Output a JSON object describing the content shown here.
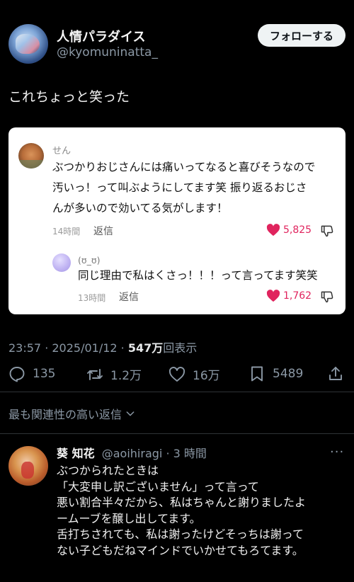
{
  "author": {
    "display_name": "人情パラダイス",
    "handle": "@kyomuninatta_",
    "follow_label": "フォローする"
  },
  "tweet": {
    "text": "これちょっと笑った"
  },
  "embedded": {
    "comment": {
      "name": "せん",
      "lines": [
        "ぶつかりおじさんには痛いってなると喜びそうなので",
        "汚いっ！って叫ぶようにしてます笑 振り返るおじさ",
        "んが多いので効いてる気がします！"
      ],
      "time": "14時間",
      "reply_label": "返信",
      "likes": "5,825"
    },
    "reply": {
      "name": "(ʊ_ʊ)",
      "text": "同じ理由で私はくさっ！！！って言ってます笑笑",
      "time": "13時間",
      "reply_label": "返信",
      "likes": "1,762"
    }
  },
  "meta": {
    "datetime": "23:57 · 2025/01/12 · ",
    "views": "547万",
    "views_suffix": "回表示"
  },
  "stats": {
    "replies": "135",
    "retweets": "1.2万",
    "likes": "16万",
    "bookmarks": "5489"
  },
  "sort": {
    "label": "最も関連性の高い返信"
  },
  "reply": {
    "name": "葵 知花",
    "handle": "@aoihiragi",
    "time": "· 3 時間",
    "more": "···",
    "lines": [
      "ぶつかられたときは",
      "「大変申し訳ございません」って言って",
      "悪い割合半々だから、私はちゃんと謝りましたよ",
      "ームーブを醸し出してます。",
      "舌打ちされても、私は謝ったけどそっちは謝って",
      "ない子どもだねマインドでいかせてもろてます。"
    ]
  },
  "colors": {
    "background": "#000000",
    "like_red": "#e0245e",
    "muted": "#8b98a5"
  }
}
